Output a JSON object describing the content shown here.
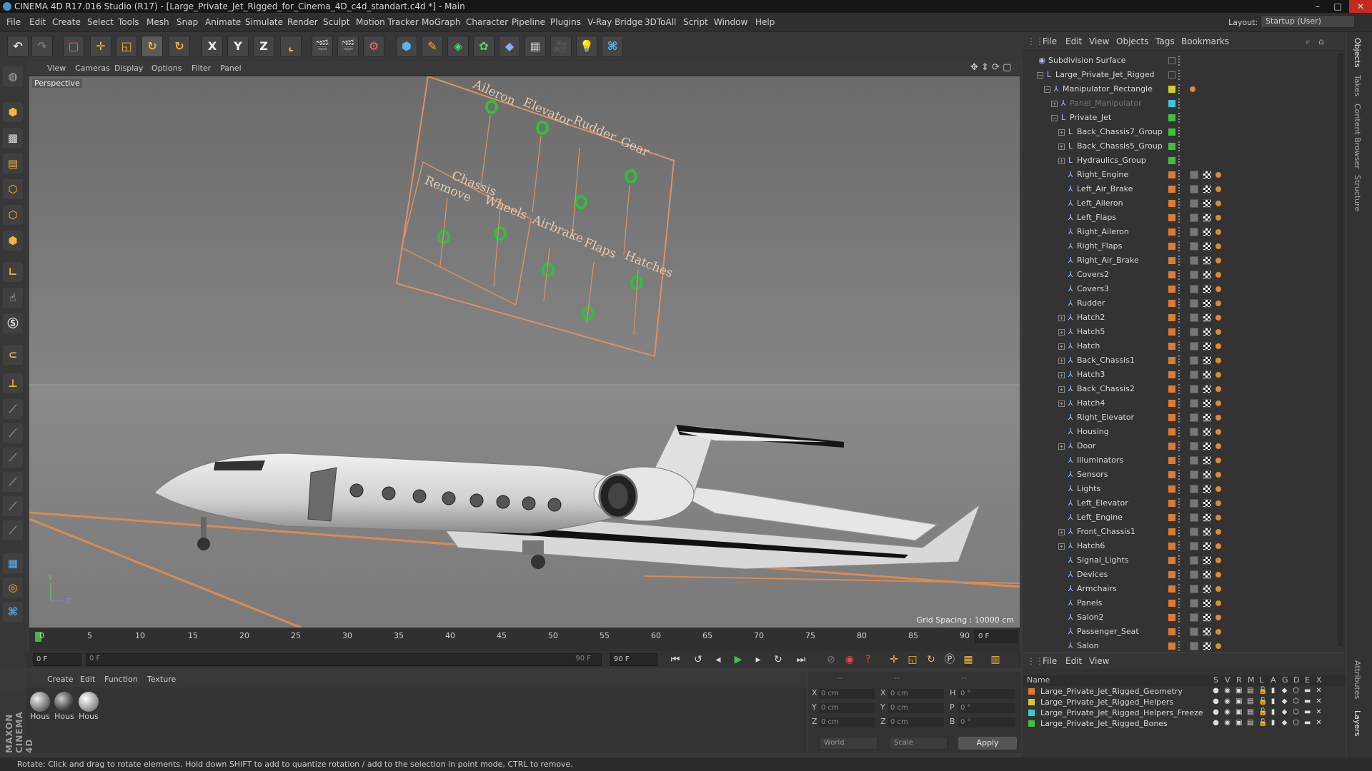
{
  "window": {
    "title": "CINEMA 4D R17.016 Studio (R17) - [Large_Private_Jet_Rigged_for_Cinema_4D_c4d_standart.c4d *] - Main",
    "controls": [
      "–",
      "□",
      "✕"
    ]
  },
  "menu": [
    "File",
    "Edit",
    "Create",
    "Select",
    "Tools",
    "Mesh",
    "Snap",
    "Animate",
    "Simulate",
    "Render",
    "Sculpt",
    "Motion Tracker",
    "MoGraph",
    "Character",
    "Pipeline",
    "Plugins",
    "V-Ray Bridge",
    "3DToAll",
    "Script",
    "Window",
    "Help"
  ],
  "layout": {
    "label": "Layout:",
    "value": "Startup (User)"
  },
  "toolbar": {
    "axis_buttons": [
      "X",
      "Y",
      "Z"
    ],
    "icons": [
      "undo-icon",
      "redo-icon",
      "live-selection-icon",
      "move-icon",
      "scale-icon",
      "rotate-icon",
      "recent-tool-icon",
      "lock-x-icon",
      "lock-y-icon",
      "lock-z-icon",
      "world-coordinates-icon",
      "render-view-icon",
      "render-picture-viewer-icon",
      "edit-render-settings-icon",
      "cube-icon",
      "pen-icon",
      "subdivision-icon",
      "array-icon",
      "deformer-icon",
      "floor-icon",
      "camera-icon",
      "light-icon",
      "python-icon"
    ]
  },
  "viewport": {
    "menu": [
      "View",
      "Cameras",
      "Display",
      "Options",
      "Filter",
      "Panel"
    ],
    "label": "Perspective",
    "grid_spacing": "Grid Spacing : 10000 cm",
    "rig_labels": [
      "Aileron",
      "Elevator",
      "Rudder",
      "Gear",
      "Chassis",
      "Remove",
      "Wheels",
      "Airbrake",
      "Flaps",
      "Hatches"
    ],
    "axis_labels": [
      "Y",
      "Z"
    ]
  },
  "timeline": {
    "ticks": [
      "0",
      "5",
      "10",
      "15",
      "20",
      "25",
      "30",
      "35",
      "40",
      "45",
      "50",
      "55",
      "60",
      "65",
      "70",
      "75",
      "80",
      "85",
      "90"
    ],
    "current_frame_field": "0 F",
    "start_field": "0 F",
    "range_start": "0 F",
    "range_end": "90 F",
    "end_field": "90 F"
  },
  "material_manager": {
    "menu": [
      "Create",
      "Edit",
      "Function",
      "Texture"
    ],
    "materials": [
      "Hous",
      "Hous",
      "Hous"
    ]
  },
  "coordinates": {
    "header": [
      "--",
      "--",
      "--"
    ],
    "rows": [
      {
        "a": "X",
        "av": "0 cm",
        "b": "X",
        "bv": "0 cm",
        "c": "H",
        "cv": "0 °"
      },
      {
        "a": "Y",
        "av": "0 cm",
        "b": "Y",
        "bv": "0 cm",
        "c": "P",
        "cv": "0 °"
      },
      {
        "a": "Z",
        "av": "0 cm",
        "b": "Z",
        "bv": "0 cm",
        "c": "B",
        "cv": "0 °"
      }
    ],
    "mode1": "World",
    "mode2": "Scale",
    "apply": "Apply"
  },
  "brand": "MAXON CINEMA 4D",
  "status": "Rotate: Click and drag to rotate elements. Hold down SHIFT to add to quantize rotation / add to the selection in point mode, CTRL to remove.",
  "object_manager": {
    "menu": [
      "File",
      "Edit",
      "View",
      "Objects",
      "Tags",
      "Bookmarks"
    ],
    "objects": [
      {
        "name": "Subdivision Surface",
        "indent": 0,
        "icon": "◉",
        "tw": "",
        "layer": "",
        "tags": []
      },
      {
        "name": "Large_Private_Jet_Rigged",
        "indent": 1,
        "icon": "L",
        "tw": "−",
        "layer": "",
        "tags": []
      },
      {
        "name": "Manipulator_Rectangle",
        "indent": 2,
        "icon": "⅄",
        "tw": "−",
        "layer": "#d8c930",
        "tags": [
          "o"
        ]
      },
      {
        "name": "Panel_Manipulator",
        "indent": 3,
        "icon": "⅄",
        "tw": "+",
        "layer": "#38c8d8",
        "tags": [],
        "dim": true
      },
      {
        "name": "Private_Jet",
        "indent": 3,
        "icon": "L",
        "tw": "−",
        "layer": "#40c040",
        "tags": []
      },
      {
        "name": "Back_Chassis7_Group",
        "indent": 4,
        "icon": "L",
        "tw": "+",
        "layer": "#40c040",
        "tags": []
      },
      {
        "name": "Back_Chassis5_Group",
        "indent": 4,
        "icon": "L",
        "tw": "+",
        "layer": "#40c040",
        "tags": []
      },
      {
        "name": "Hydraulics_Group",
        "indent": 4,
        "icon": "L",
        "tw": "+",
        "layer": "#40c040",
        "tags": []
      },
      {
        "name": "Right_Engine",
        "indent": 4,
        "icon": "⅄",
        "tw": "",
        "layer": "#e07a30",
        "tags": [
          "m",
          "c",
          "o"
        ]
      },
      {
        "name": "Left_Air_Brake",
        "indent": 4,
        "icon": "⅄",
        "tw": "",
        "layer": "#e07a30",
        "tags": [
          "m",
          "c",
          "o"
        ]
      },
      {
        "name": "Left_Aileron",
        "indent": 4,
        "icon": "⅄",
        "tw": "",
        "layer": "#e07a30",
        "tags": [
          "m",
          "c",
          "o"
        ]
      },
      {
        "name": "Left_Flaps",
        "indent": 4,
        "icon": "⅄",
        "tw": "",
        "layer": "#e07a30",
        "tags": [
          "m",
          "c",
          "o"
        ]
      },
      {
        "name": "Right_Aileron",
        "indent": 4,
        "icon": "⅄",
        "tw": "",
        "layer": "#e07a30",
        "tags": [
          "m",
          "c",
          "o"
        ]
      },
      {
        "name": "Right_Flaps",
        "indent": 4,
        "icon": "⅄",
        "tw": "",
        "layer": "#e07a30",
        "tags": [
          "m",
          "c",
          "o"
        ]
      },
      {
        "name": "Right_Air_Brake",
        "indent": 4,
        "icon": "⅄",
        "tw": "",
        "layer": "#e07a30",
        "tags": [
          "m",
          "c",
          "o"
        ]
      },
      {
        "name": "Covers2",
        "indent": 4,
        "icon": "⅄",
        "tw": "",
        "layer": "#e07a30",
        "tags": [
          "m",
          "c",
          "o"
        ]
      },
      {
        "name": "Covers3",
        "indent": 4,
        "icon": "⅄",
        "tw": "",
        "layer": "#e07a30",
        "tags": [
          "m",
          "c",
          "o"
        ]
      },
      {
        "name": "Rudder",
        "indent": 4,
        "icon": "⅄",
        "tw": "",
        "layer": "#e07a30",
        "tags": [
          "m",
          "c",
          "o"
        ]
      },
      {
        "name": "Hatch2",
        "indent": 4,
        "icon": "⅄",
        "tw": "+",
        "layer": "#e07a30",
        "tags": [
          "m",
          "c",
          "o"
        ]
      },
      {
        "name": "Hatch5",
        "indent": 4,
        "icon": "⅄",
        "tw": "+",
        "layer": "#e07a30",
        "tags": [
          "m",
          "c",
          "o"
        ]
      },
      {
        "name": "Hatch",
        "indent": 4,
        "icon": "⅄",
        "tw": "+",
        "layer": "#e07a30",
        "tags": [
          "m",
          "c",
          "o"
        ]
      },
      {
        "name": "Back_Chassis1",
        "indent": 4,
        "icon": "⅄",
        "tw": "+",
        "layer": "#e07a30",
        "tags": [
          "m",
          "c",
          "o"
        ]
      },
      {
        "name": "Hatch3",
        "indent": 4,
        "icon": "⅄",
        "tw": "+",
        "layer": "#e07a30",
        "tags": [
          "m",
          "c",
          "o"
        ]
      },
      {
        "name": "Back_Chassis2",
        "indent": 4,
        "icon": "⅄",
        "tw": "+",
        "layer": "#e07a30",
        "tags": [
          "m",
          "c",
          "o"
        ]
      },
      {
        "name": "Hatch4",
        "indent": 4,
        "icon": "⅄",
        "tw": "+",
        "layer": "#e07a30",
        "tags": [
          "m",
          "c",
          "o"
        ]
      },
      {
        "name": "Right_Elevator",
        "indent": 4,
        "icon": "⅄",
        "tw": "",
        "layer": "#e07a30",
        "tags": [
          "m",
          "c",
          "o"
        ]
      },
      {
        "name": "Housing",
        "indent": 4,
        "icon": "⅄",
        "tw": "",
        "layer": "#e07a30",
        "tags": [
          "m",
          "c",
          "o"
        ]
      },
      {
        "name": "Door",
        "indent": 4,
        "icon": "⅄",
        "tw": "+",
        "layer": "#e07a30",
        "tags": [
          "m",
          "c",
          "o"
        ]
      },
      {
        "name": "Illuminators",
        "indent": 4,
        "icon": "⅄",
        "tw": "",
        "layer": "#e07a30",
        "tags": [
          "m",
          "c",
          "o"
        ]
      },
      {
        "name": "Sensors",
        "indent": 4,
        "icon": "⅄",
        "tw": "",
        "layer": "#e07a30",
        "tags": [
          "m",
          "c",
          "o"
        ]
      },
      {
        "name": "Lights",
        "indent": 4,
        "icon": "⅄",
        "tw": "",
        "layer": "#e07a30",
        "tags": [
          "m",
          "c",
          "o"
        ]
      },
      {
        "name": "Left_Elevator",
        "indent": 4,
        "icon": "⅄",
        "tw": "",
        "layer": "#e07a30",
        "tags": [
          "m",
          "c",
          "o"
        ]
      },
      {
        "name": "Left_Engine",
        "indent": 4,
        "icon": "⅄",
        "tw": "",
        "layer": "#e07a30",
        "tags": [
          "m",
          "c",
          "o"
        ]
      },
      {
        "name": "Front_Chassis1",
        "indent": 4,
        "icon": "⅄",
        "tw": "+",
        "layer": "#e07a30",
        "tags": [
          "m",
          "c",
          "o"
        ]
      },
      {
        "name": "Hatch6",
        "indent": 4,
        "icon": "⅄",
        "tw": "+",
        "layer": "#e07a30",
        "tags": [
          "m",
          "c",
          "o"
        ]
      },
      {
        "name": "Signal_Lights",
        "indent": 4,
        "icon": "⅄",
        "tw": "",
        "layer": "#e07a30",
        "tags": [
          "m",
          "c",
          "o"
        ]
      },
      {
        "name": "Devices",
        "indent": 4,
        "icon": "⅄",
        "tw": "",
        "layer": "#e07a30",
        "tags": [
          "m",
          "c",
          "o"
        ]
      },
      {
        "name": "Armchairs",
        "indent": 4,
        "icon": "⅄",
        "tw": "",
        "layer": "#e07a30",
        "tags": [
          "m",
          "c",
          "o"
        ]
      },
      {
        "name": "Panels",
        "indent": 4,
        "icon": "⅄",
        "tw": "",
        "layer": "#e07a30",
        "tags": [
          "m",
          "c",
          "o"
        ]
      },
      {
        "name": "Salon2",
        "indent": 4,
        "icon": "⅄",
        "tw": "",
        "layer": "#e07a30",
        "tags": [
          "m",
          "c",
          "o"
        ]
      },
      {
        "name": "Passenger_Seat",
        "indent": 4,
        "icon": "⅄",
        "tw": "",
        "layer": "#e07a30",
        "tags": [
          "m",
          "c",
          "o"
        ]
      },
      {
        "name": "Salon",
        "indent": 4,
        "icon": "⅄",
        "tw": "",
        "layer": "#e07a30",
        "tags": [
          "m",
          "c",
          "o"
        ]
      }
    ]
  },
  "right_tabs": [
    "Objects",
    "Takes",
    "Content Browser",
    "Structure",
    "Attributes",
    "Layers"
  ],
  "layer_manager": {
    "menu": [
      "File",
      "Edit",
      "View"
    ],
    "header": {
      "name": "Name",
      "flags": [
        "S",
        "V",
        "R",
        "M",
        "L",
        "A",
        "G",
        "D",
        "E",
        "X"
      ]
    },
    "layers": [
      {
        "name": "Large_Private_Jet_Rigged_Geometry",
        "color": "#e07a30"
      },
      {
        "name": "Large_Private_Jet_Rigged_Helpers",
        "color": "#d8c930"
      },
      {
        "name": "Large_Private_Jet_Rigged_Helpers_Freeze",
        "color": "#38c8d8"
      },
      {
        "name": "Large_Private_Jet_Rigged_Bones",
        "color": "#40c040"
      }
    ]
  }
}
